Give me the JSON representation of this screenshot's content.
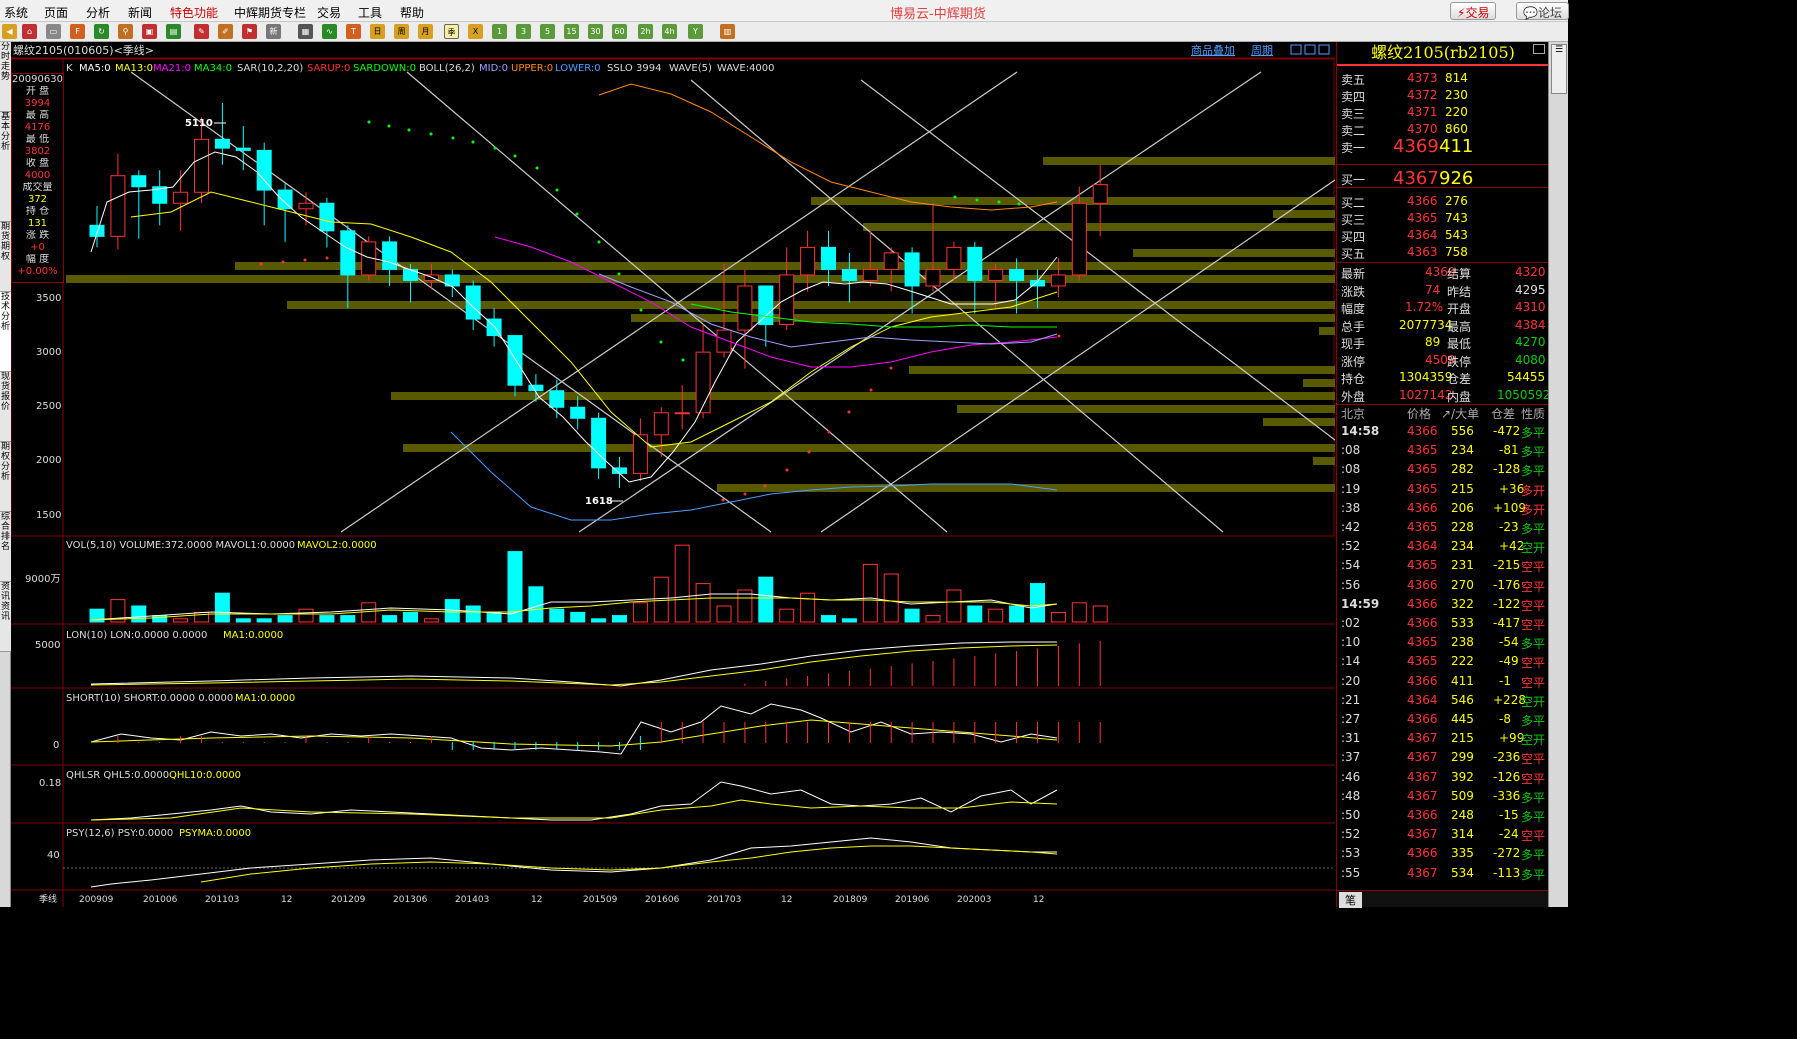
{
  "menu": {
    "items": [
      "系统",
      "页面",
      "分析",
      "新闻",
      "特色功能",
      "中辉期货专栏",
      "交易",
      "工具",
      "帮助"
    ],
    "app_title": "博易云-中辉期货",
    "trade_btn": "交易",
    "forum_btn": "论坛"
  },
  "toolbar": {
    "period_buttons": [
      "日",
      "周",
      "月",
      "季",
      "X",
      "1",
      "3",
      "5",
      "15",
      "30",
      "60",
      "2h",
      "4h",
      "Y"
    ]
  },
  "left_tabs": [
    "分时走势",
    "基本分析",
    "期货期权",
    "技术分析",
    "现货报价",
    "期权分析",
    "综合排名",
    "资讯资讯"
  ],
  "chart": {
    "symbol_title": "螺纹2105(010605)<季线>",
    "top_links": {
      "overlay": "商品叠加",
      "period": "周期"
    },
    "indicator_line": {
      "k": "K",
      "ma5": "MA5:0",
      "ma13": "MA13:0",
      "ma21": "MA21:0",
      "ma34": "MA34:0",
      "sar": "SAR(10,2,20)",
      "sarup": "SARUP:0",
      "sardown": "SARDOWN:0",
      "boll": "BOLL(26,2)",
      "mid": "MID:0",
      "upper": "UPPER:0",
      "lower": "LOWER:0",
      "sslo": "SSLO",
      "sslo_val": "3994",
      "wave": "WAVE(5)",
      "wave_val": "WAVE:4000"
    },
    "price_axis": [
      "3500",
      "3000",
      "2500",
      "2000",
      "1500"
    ],
    "high_label": "5110",
    "low_label": "1618",
    "infobox": {
      "date": "20090630",
      "open_label": "开 盘",
      "open": "3994",
      "high_label": "最 高",
      "high": "4176",
      "low_label": "最 低",
      "low": "3802",
      "close_label": "收 盘",
      "close": "4000",
      "vol_label": "成交量",
      "vol": "372",
      "oi_label": "持 仓",
      "oi": "131",
      "chg_label": "涨 跌",
      "chg": "+0",
      "pct_label": "幅 度",
      "pct": "+0.00%"
    },
    "vol_panel": {
      "title": "VOL(5,10) VOLUME:372.0000 MAVOL1:0.0000",
      "mavol2": "MAVOL2:0.0000",
      "axis": "9000万"
    },
    "lon_panel": {
      "title": "LON(10) LON:0.0000 0.0000",
      "ma": "MA1:0.0000",
      "axis": "5000"
    },
    "short_panel": {
      "title": "SHORT(10) SHORT:0.0000 0.0000",
      "ma": "MA1:0.0000",
      "axis": "0"
    },
    "qhlsr_panel": {
      "title": "QHLSR QHL5:0.0000",
      "ma": "QHL10:0.0000",
      "axis": "0.18"
    },
    "psy_panel": {
      "title": "PSY(12,6) PSY:0.0000",
      "ma": "PSYMA:0.0000",
      "axis": "40"
    },
    "x_axis": {
      "period": "季线",
      "labels": [
        "200909",
        "201006",
        "201103",
        "12",
        "201209",
        "201306",
        "201403",
        "12",
        "201509",
        "201606",
        "201703",
        "12",
        "201809",
        "201906",
        "202003",
        "12"
      ]
    }
  },
  "chart_data": {
    "type": "candlestick",
    "title": "螺纹2105(010605)<季线>",
    "candles": [
      {
        "o": 4000,
        "c": 3900,
        "h": 4176,
        "l": 3802
      },
      {
        "o": 3900,
        "c": 4450,
        "h": 4650,
        "l": 3780
      },
      {
        "o": 4450,
        "c": 4350,
        "h": 4500,
        "l": 3880
      },
      {
        "o": 4350,
        "c": 4200,
        "h": 4500,
        "l": 4000
      },
      {
        "o": 4200,
        "c": 4300,
        "h": 4500,
        "l": 3950
      },
      {
        "o": 4300,
        "c": 4780,
        "h": 4980,
        "l": 4200
      },
      {
        "o": 4780,
        "c": 4700,
        "h": 5110,
        "l": 4550
      },
      {
        "o": 4700,
        "c": 4680,
        "h": 4900,
        "l": 4500
      },
      {
        "o": 4680,
        "c": 4320,
        "h": 4750,
        "l": 4000
      },
      {
        "o": 4320,
        "c": 4150,
        "h": 4380,
        "l": 3850
      },
      {
        "o": 4150,
        "c": 4200,
        "h": 4300,
        "l": 4000
      },
      {
        "o": 4200,
        "c": 3950,
        "h": 4250,
        "l": 3800
      },
      {
        "o": 3950,
        "c": 3550,
        "h": 4000,
        "l": 3250
      },
      {
        "o": 3550,
        "c": 3850,
        "h": 3900,
        "l": 3500
      },
      {
        "o": 3850,
        "c": 3600,
        "h": 3900,
        "l": 3450
      },
      {
        "o": 3600,
        "c": 3500,
        "h": 3650,
        "l": 3300
      },
      {
        "o": 3500,
        "c": 3550,
        "h": 3650,
        "l": 3420
      },
      {
        "o": 3550,
        "c": 3450,
        "h": 3600,
        "l": 3350
      },
      {
        "o": 3450,
        "c": 3150,
        "h": 3500,
        "l": 3050
      },
      {
        "o": 3150,
        "c": 3000,
        "h": 3250,
        "l": 2900
      },
      {
        "o": 3000,
        "c": 2550,
        "h": 3000,
        "l": 2450
      },
      {
        "o": 2550,
        "c": 2500,
        "h": 2650,
        "l": 2400
      },
      {
        "o": 2500,
        "c": 2350,
        "h": 2600,
        "l": 2250
      },
      {
        "o": 2350,
        "c": 2250,
        "h": 2450,
        "l": 2150
      },
      {
        "o": 2250,
        "c": 1800,
        "h": 2300,
        "l": 1700
      },
      {
        "o": 1800,
        "c": 1750,
        "h": 1900,
        "l": 1618
      },
      {
        "o": 1750,
        "c": 2100,
        "h": 2250,
        "l": 1680
      },
      {
        "o": 2100,
        "c": 2300,
        "h": 2350,
        "l": 1900
      },
      {
        "o": 2300,
        "c": 2300,
        "h": 2550,
        "l": 2150
      },
      {
        "o": 2300,
        "c": 2850,
        "h": 3100,
        "l": 2250
      },
      {
        "o": 2850,
        "c": 3050,
        "h": 3650,
        "l": 2800
      },
      {
        "o": 3050,
        "c": 3450,
        "h": 3600,
        "l": 2700
      },
      {
        "o": 3450,
        "c": 3100,
        "h": 3450,
        "l": 2900
      },
      {
        "o": 3100,
        "c": 3550,
        "h": 3800,
        "l": 3050
      },
      {
        "o": 3550,
        "c": 3800,
        "h": 3950,
        "l": 3400
      },
      {
        "o": 3800,
        "c": 3600,
        "h": 3950,
        "l": 3450
      },
      {
        "o": 3600,
        "c": 3500,
        "h": 3750,
        "l": 3300
      },
      {
        "o": 3500,
        "c": 3600,
        "h": 3950,
        "l": 3450
      },
      {
        "o": 3600,
        "c": 3750,
        "h": 3800,
        "l": 3400
      },
      {
        "o": 3750,
        "c": 3450,
        "h": 3800,
        "l": 3200
      },
      {
        "o": 3450,
        "c": 3600,
        "h": 4200,
        "l": 3400
      },
      {
        "o": 3600,
        "c": 3800,
        "h": 3850,
        "l": 3500
      },
      {
        "o": 3800,
        "c": 3500,
        "h": 3850,
        "l": 3200
      },
      {
        "o": 3500,
        "c": 3600,
        "h": 3650,
        "l": 3250
      },
      {
        "o": 3600,
        "c": 3500,
        "h": 3700,
        "l": 3200
      },
      {
        "o": 3500,
        "c": 3450,
        "h": 3600,
        "l": 3250
      },
      {
        "o": 3450,
        "c": 3550,
        "h": 3700,
        "l": 3350
      },
      {
        "o": 3550,
        "c": 4200,
        "h": 4350,
        "l": 3500
      },
      {
        "o": 4200,
        "c": 4369,
        "h": 4550,
        "l": 3900
      }
    ],
    "price_axis": [
      3500,
      3000,
      2500,
      2000,
      1500
    ],
    "ylim": [
      1400,
      5300
    ]
  },
  "quote": {
    "name": "螺纹2105(rb2105)",
    "asks": [
      {
        "label": "卖五",
        "price": "4373",
        "vol": "814"
      },
      {
        "label": "卖四",
        "price": "4372",
        "vol": "230"
      },
      {
        "label": "卖三",
        "price": "4371",
        "vol": "220"
      },
      {
        "label": "卖二",
        "price": "4370",
        "vol": "860"
      },
      {
        "label": "卖一",
        "price": "4369",
        "vol": "411"
      }
    ],
    "bids": [
      {
        "label": "买一",
        "price": "4367",
        "vol": "926"
      },
      {
        "label": "买二",
        "price": "4366",
        "vol": "276"
      },
      {
        "label": "买三",
        "price": "4365",
        "vol": "743"
      },
      {
        "label": "买四",
        "price": "4364",
        "vol": "543"
      },
      {
        "label": "买五",
        "price": "4363",
        "vol": "758"
      }
    ],
    "stats": [
      {
        "l1": "最新",
        "v1": "4369",
        "l2": "结算",
        "v2": "4320",
        "c1": "redt",
        "c2": "redt"
      },
      {
        "l1": "涨跌",
        "v1": "74",
        "l2": "昨结",
        "v2": "4295",
        "c1": "redt",
        "c2": "white"
      },
      {
        "l1": "幅度",
        "v1": "1.72%",
        "l2": "开盘",
        "v2": "4310",
        "c1": "redt",
        "c2": "redt"
      },
      {
        "l1": "总手",
        "v1": "2077734",
        "l2": "最高",
        "v2": "4384",
        "c1": "yel",
        "c2": "redt"
      },
      {
        "l1": "现手",
        "v1": "89",
        "l2": "最低",
        "v2": "4270",
        "c1": "yel",
        "c2": "green"
      },
      {
        "l1": "涨停",
        "v1": "4509",
        "l2": "跌停",
        "v2": "4080",
        "c1": "redt",
        "c2": "green"
      },
      {
        "l1": "持仓",
        "v1": "1304359",
        "l2": "仓差",
        "v2": "54455",
        "c1": "yel",
        "c2": "yel"
      },
      {
        "l1": "外盘",
        "v1": "1027142",
        "l2": "内盘",
        "v2": "1050592",
        "c1": "redt",
        "c2": "green"
      }
    ],
    "tick_header": {
      "loc": "北京",
      "price": "价格",
      "vol": "↗/大单",
      "oi": "仓差",
      "nature": "性质"
    },
    "ticks": [
      {
        "t": "14:58",
        "p": "4366",
        "v": "556",
        "d": "-472",
        "n": "多平",
        "pc": "redt",
        "nc": "green"
      },
      {
        "t": ":08",
        "p": "4365",
        "v": "234",
        "d": "-81",
        "n": "多平",
        "pc": "redt",
        "nc": "green"
      },
      {
        "t": ":08",
        "p": "4365",
        "v": "282",
        "d": "-128",
        "n": "多平",
        "pc": "redt",
        "nc": "green"
      },
      {
        "t": ":19",
        "p": "4365",
        "v": "215",
        "d": "+36",
        "n": "多开",
        "pc": "redt",
        "nc": "redt"
      },
      {
        "t": ":38",
        "p": "4366",
        "v": "206",
        "d": "+109",
        "n": "多开",
        "pc": "redt",
        "nc": "redt"
      },
      {
        "t": ":42",
        "p": "4365",
        "v": "228",
        "d": "-23",
        "n": "多平",
        "pc": "redt",
        "nc": "green"
      },
      {
        "t": ":52",
        "p": "4364",
        "v": "234",
        "d": "+42",
        "n": "空开",
        "pc": "redt",
        "nc": "green"
      },
      {
        "t": ":54",
        "p": "4365",
        "v": "231",
        "d": "-215",
        "n": "空平",
        "pc": "redt",
        "nc": "redt"
      },
      {
        "t": ":56",
        "p": "4366",
        "v": "270",
        "d": "-176",
        "n": "空平",
        "pc": "redt",
        "nc": "redt"
      },
      {
        "t": "14:59",
        "p": "4366",
        "v": "322",
        "d": "-122",
        "n": "空平",
        "pc": "redt",
        "nc": "redt"
      },
      {
        "t": ":02",
        "p": "4366",
        "v": "533",
        "d": "-417",
        "n": "空平",
        "pc": "redt",
        "nc": "redt"
      },
      {
        "t": ":10",
        "p": "4365",
        "v": "238",
        "d": "-54",
        "n": "多平",
        "pc": "redt",
        "nc": "green"
      },
      {
        "t": ":14",
        "p": "4365",
        "v": "222",
        "d": "-49",
        "n": "空平",
        "pc": "redt",
        "nc": "redt"
      },
      {
        "t": ":20",
        "p": "4366",
        "v": "411",
        "d": "-1",
        "n": "空平",
        "pc": "redt",
        "nc": "redt"
      },
      {
        "t": ":21",
        "p": "4364",
        "v": "546",
        "d": "+228",
        "n": "空开",
        "pc": "redt",
        "nc": "green"
      },
      {
        "t": ":27",
        "p": "4366",
        "v": "445",
        "d": "-8",
        "n": "多平",
        "pc": "redt",
        "nc": "green"
      },
      {
        "t": ":31",
        "p": "4367",
        "v": "215",
        "d": "+99",
        "n": "空开",
        "pc": "redt",
        "nc": "green"
      },
      {
        "t": ":37",
        "p": "4367",
        "v": "299",
        "d": "-236",
        "n": "空平",
        "pc": "redt",
        "nc": "redt"
      },
      {
        "t": ":46",
        "p": "4367",
        "v": "392",
        "d": "-126",
        "n": "空平",
        "pc": "redt",
        "nc": "redt"
      },
      {
        "t": ":48",
        "p": "4367",
        "v": "509",
        "d": "-336",
        "n": "多平",
        "pc": "redt",
        "nc": "green"
      },
      {
        "t": ":50",
        "p": "4366",
        "v": "248",
        "d": "-15",
        "n": "多平",
        "pc": "redt",
        "nc": "green"
      },
      {
        "t": ":52",
        "p": "4367",
        "v": "314",
        "d": "-24",
        "n": "空平",
        "pc": "redt",
        "nc": "redt"
      },
      {
        "t": ":53",
        "p": "4366",
        "v": "335",
        "d": "-272",
        "n": "多平",
        "pc": "redt",
        "nc": "green"
      },
      {
        "t": ":55",
        "p": "4367",
        "v": "534",
        "d": "-113",
        "n": "多平",
        "pc": "redt",
        "nc": "green"
      }
    ],
    "bottom_tab": "笔"
  },
  "colors": {
    "up": "#ff3232",
    "down": "#00ffff",
    "ma5": "#ffffff",
    "ma13": "#ffff00",
    "ma21": "#ff00ff",
    "ma34": "#00ff00",
    "grid": "#800000",
    "bar": "#808000"
  }
}
